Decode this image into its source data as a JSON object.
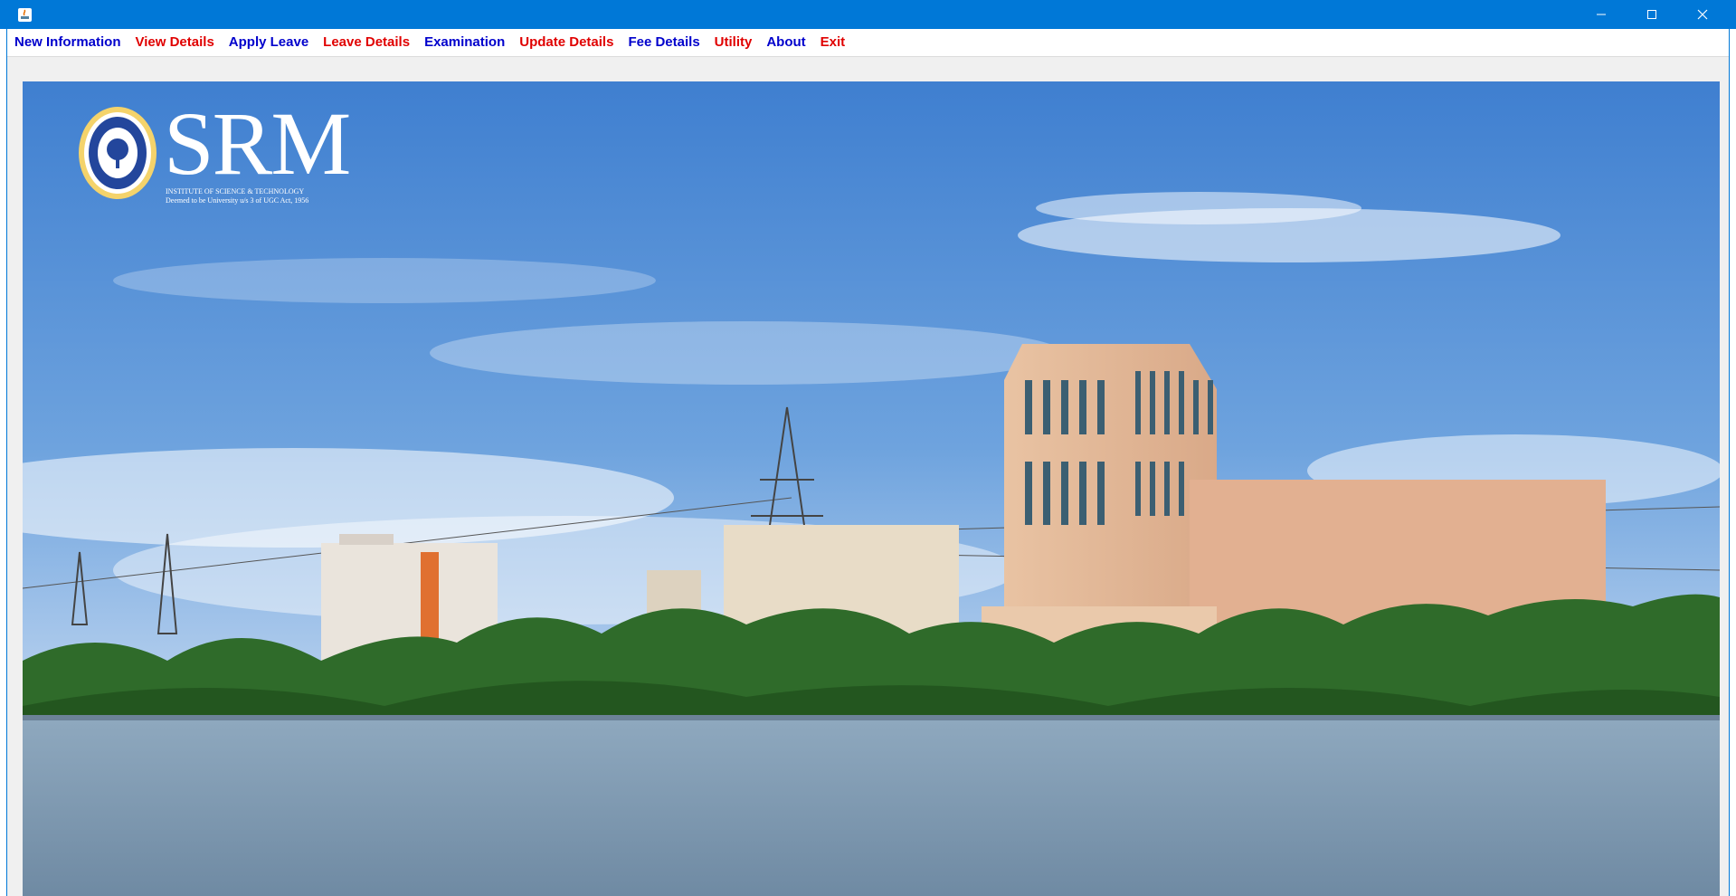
{
  "window": {
    "minimize_icon": "minimize-icon",
    "maximize_icon": "maximize-icon",
    "close_icon": "close-icon",
    "titlebar_color": "#0078d7"
  },
  "menu": {
    "items": [
      {
        "label": "New Information",
        "color": "#0000cc"
      },
      {
        "label": "View Details",
        "color": "#e00000"
      },
      {
        "label": "Apply Leave",
        "color": "#0000cc"
      },
      {
        "label": "Leave Details",
        "color": "#e00000"
      },
      {
        "label": "Examination",
        "color": "#0000cc"
      },
      {
        "label": "Update Details",
        "color": "#e00000"
      },
      {
        "label": "Fee Details",
        "color": "#0000cc"
      },
      {
        "label": "Utility",
        "color": "#e00000"
      },
      {
        "label": "About",
        "color": "#0000cc"
      },
      {
        "label": "Exit",
        "color": "#e00000"
      }
    ]
  },
  "banner": {
    "logo_text": "SRM",
    "logo_line1": "INSTITUTE OF SCIENCE & TECHNOLOGY",
    "logo_line2": "Deemed to be University u/s 3 of UGC Act, 1956"
  }
}
